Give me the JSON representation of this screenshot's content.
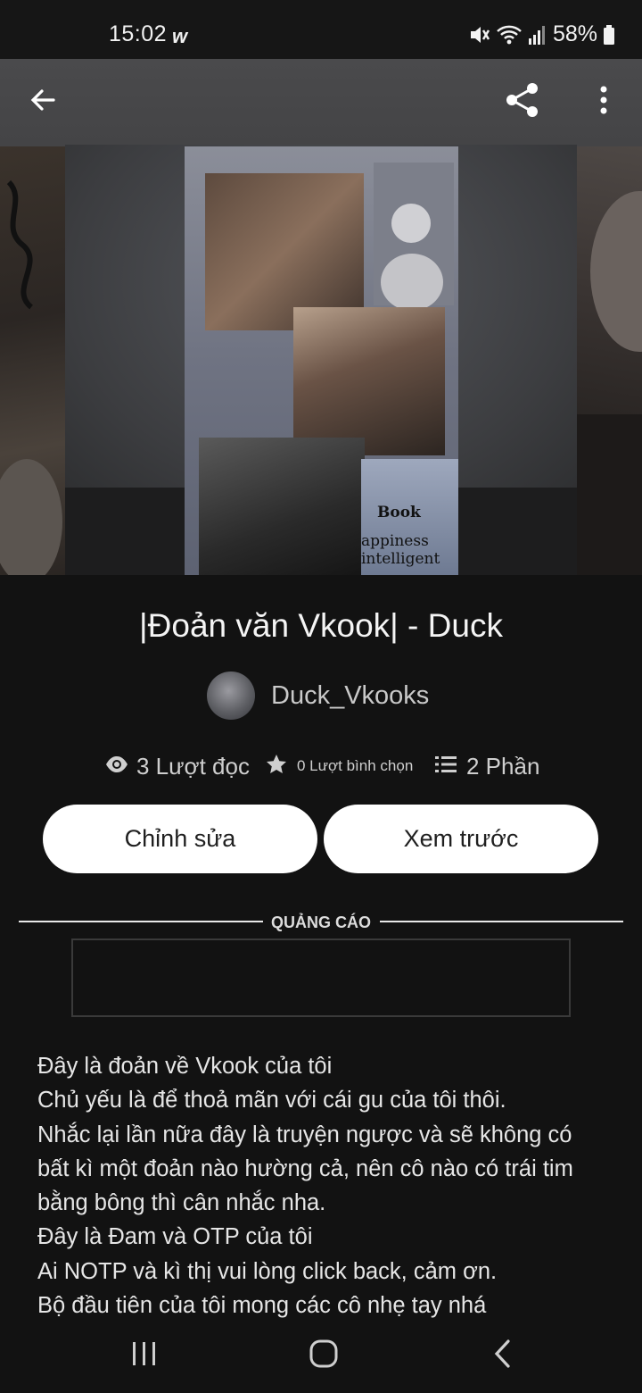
{
  "status_bar": {
    "time": "15:02",
    "app_icon": "w-icon",
    "icons": [
      "mute-icon",
      "wifi-icon",
      "signal-icon",
      "battery-icon"
    ],
    "battery": "58%"
  },
  "toolbar": {
    "back_icon": "arrow-left-icon",
    "share_icon": "share-icon",
    "more_icon": "more-vertical-icon"
  },
  "cover_text": {
    "line1": "Book",
    "line2": "appiness",
    "line3": "intelligent"
  },
  "story": {
    "title": "|Đoản văn Vkook| - Duck",
    "author": "Duck_Vkooks"
  },
  "stats": {
    "reads": "3 Lượt đọc",
    "votes": "0 Lượt bình chọn",
    "parts": "2 Phần"
  },
  "actions": {
    "edit": "Chỉnh sửa",
    "preview": "Xem trước"
  },
  "ad": {
    "label": "QUẢNG CÁO"
  },
  "description": [
    "Đây là đoản về Vkook của tôi",
    "Chủ yếu là để thoả mãn với cái gu của tôi thôi.",
    "Nhắc lại lần nữa đây là truyện ngược và sẽ không có",
    "bất kì một đoản nào hường cả, nên cô nào có trái tim",
    "bằng bông thì cân nhắc nha.",
    "Đây là Đam và OTP của tôi",
    "Ai NOTP và kì thị vui lòng click back, cảm ơn.",
    "Bộ đầu tiên của tôi mong các cô nhẹ tay nhá"
  ],
  "colors": {
    "background": "#121212",
    "button_bg": "#ffffff",
    "button_text": "#202020",
    "text": "#e6e6e6"
  }
}
